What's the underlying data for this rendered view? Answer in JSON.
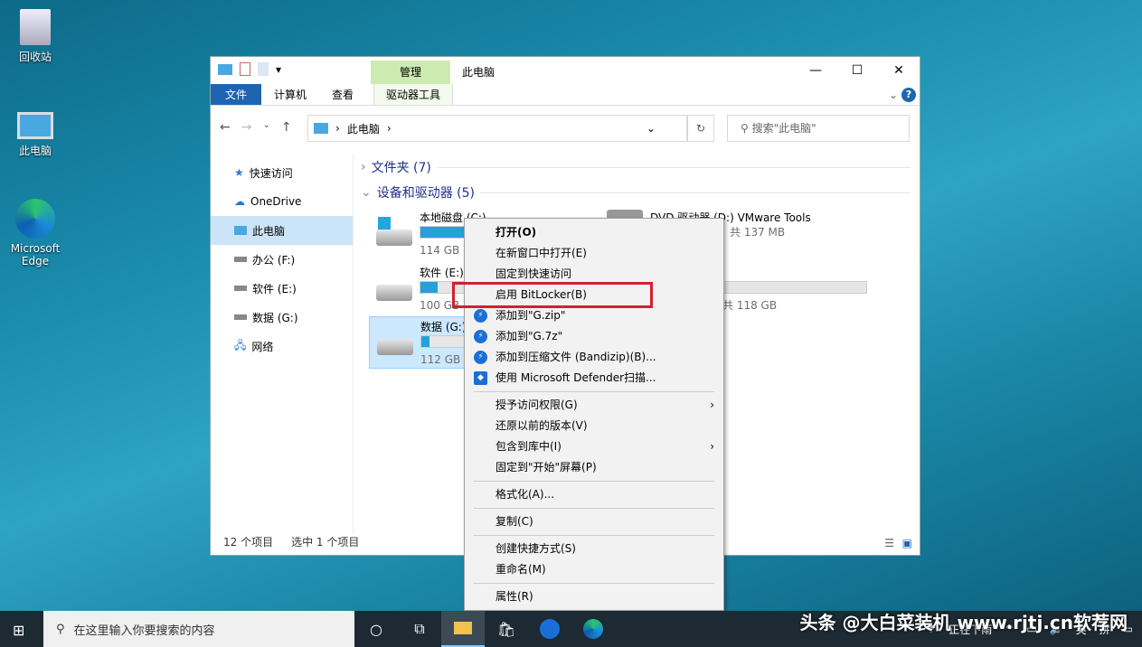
{
  "desktop": {
    "icons": [
      {
        "label": "回收站"
      },
      {
        "label": "此电脑"
      },
      {
        "label": "Microsoft Edge"
      }
    ]
  },
  "window": {
    "title": "此电脑",
    "context_tab": "管理",
    "tabs": [
      "文件",
      "计算机",
      "查看",
      "驱动器工具"
    ],
    "controls": {
      "minimize": "—",
      "maximize": "☐",
      "close": "✕"
    },
    "help": "?"
  },
  "address": {
    "crumb": "此电脑",
    "search_placeholder": "搜索\"此电脑\""
  },
  "sidebar": [
    {
      "label": "快速访问"
    },
    {
      "label": "OneDrive"
    },
    {
      "label": "此电脑"
    },
    {
      "label": "办公 (F:)"
    },
    {
      "label": "软件 (E:)"
    },
    {
      "label": "数据 (G:)"
    },
    {
      "label": "网络"
    }
  ],
  "groups": {
    "folders": "文件夹 (7)",
    "devices": "设备和驱动器 (5)"
  },
  "drives": [
    {
      "name": "本地磁盘 (C:)",
      "space": "114 GB 可用",
      "used": 0.3
    },
    {
      "name": "软件 (E:)",
      "space": "100 GB 可用",
      "used": 0.1
    },
    {
      "name": "数据 (G:)",
      "space": "112 GB 可用",
      "used": 0.05
    },
    {
      "name": "DVD 驱动器 (D:) VMware Tools",
      "space": "共 137 MB"
    },
    {
      "name": "",
      "space": "共 118 GB",
      "used": 0.05
    }
  ],
  "status": {
    "count": "12 个项目",
    "selected": "选中 1 个项目"
  },
  "context_menu": [
    "打开(O)",
    "在新窗口中打开(E)",
    "固定到快速访问",
    "启用 BitLocker(B)",
    "添加到\"G.zip\"",
    "添加到\"G.7z\"",
    "添加到压缩文件 (Bandizip)(B)...",
    "使用 Microsoft Defender扫描...",
    "授予访问权限(G)",
    "还原以前的版本(V)",
    "包含到库中(I)",
    "固定到\"开始\"屏幕(P)",
    "格式化(A)...",
    "复制(C)",
    "创建快捷方式(S)",
    "重命名(M)",
    "属性(R)"
  ],
  "taskbar": {
    "search_placeholder": "在这里输入你要搜索的内容",
    "weather": "正在下雨",
    "ime": "英",
    "ime2": "拼"
  },
  "watermark": "头条 @大白菜装机 www.rjtj.cn软荐网",
  "colors": {
    "accent": "#1f64b0",
    "highlight": "#d32030"
  }
}
